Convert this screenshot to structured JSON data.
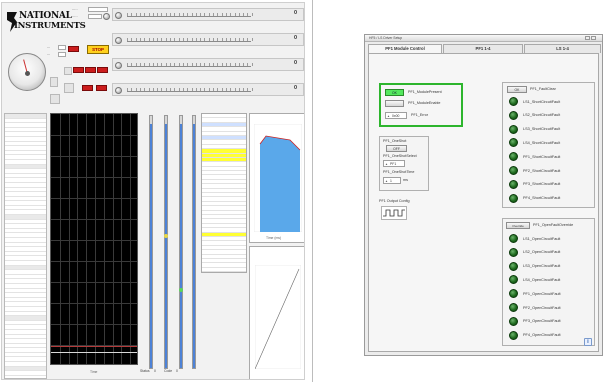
{
  "left_panel": {
    "logo": {
      "line1": "NATIONAL",
      "line2": "INSTRUMENTS"
    },
    "stop_label": "STOP",
    "slider_readouts": [
      {
        "value": "0"
      },
      {
        "value": "0"
      },
      {
        "value": "0"
      },
      {
        "value": "0"
      }
    ],
    "main_graph": {
      "x_label": "Time"
    },
    "side_chart_top": {
      "x_label": "Time (ms)"
    },
    "status_rows": [
      {
        "label": "Status",
        "value": "0"
      },
      {
        "label": "Code",
        "value": "0"
      }
    ]
  },
  "right_window": {
    "title": "HF5 / LS Driver Setup",
    "tabs": [
      {
        "label": "PF1 Module Control"
      },
      {
        "label": "PF1 1-4"
      },
      {
        "label": "LS 1-4"
      }
    ],
    "module": {
      "present_btn": "OK",
      "present_label": "PF1_ModulePresent",
      "enable_btn": "",
      "enable_label": "PF1_ModuleEnable",
      "error_value": "0x00",
      "error_label": "PF1_Error"
    },
    "one_shot": {
      "title": "PF1_OneShot",
      "btn": "OFF",
      "select_label": "PF1_OneShotSelect",
      "select_value": "PF1",
      "time_label": "PF1_OneShotTime",
      "time_value": "1",
      "time_unit": "ms"
    },
    "output_config_label": "PF1 Output Config",
    "fault_clear": {
      "btn": "OK",
      "label": "PF1_FaultClear",
      "items": [
        "LS1_ShortCircuitFault",
        "LS2_ShortCircuitFault",
        "LS3_ShortCircuitFault",
        "LS4_ShortCircuitFault",
        "PF1_ShortCircuitFault",
        "PF2_ShortCircuitFault",
        "PF3_ShortCircuitFault",
        "PF4_ShortCircuitFault"
      ]
    },
    "open_fault": {
      "btn": "Override",
      "label": "PF1_OpenFaultOverride",
      "items": [
        "LS1_OpenCircuitFault",
        "LS2_OpenCircuitFault",
        "LS3_OpenCircuitFault",
        "LS4_OpenCircuitFault",
        "PF1_OpenCircuitFault",
        "PF2_OpenCircuitFault",
        "PF3_OpenCircuitFault",
        "PF4_OpenCircuitFault"
      ]
    },
    "info_icon": "info-icon",
    "colors": {
      "accent_green": "#2db52d",
      "led_green": "#1f6b1f"
    }
  }
}
